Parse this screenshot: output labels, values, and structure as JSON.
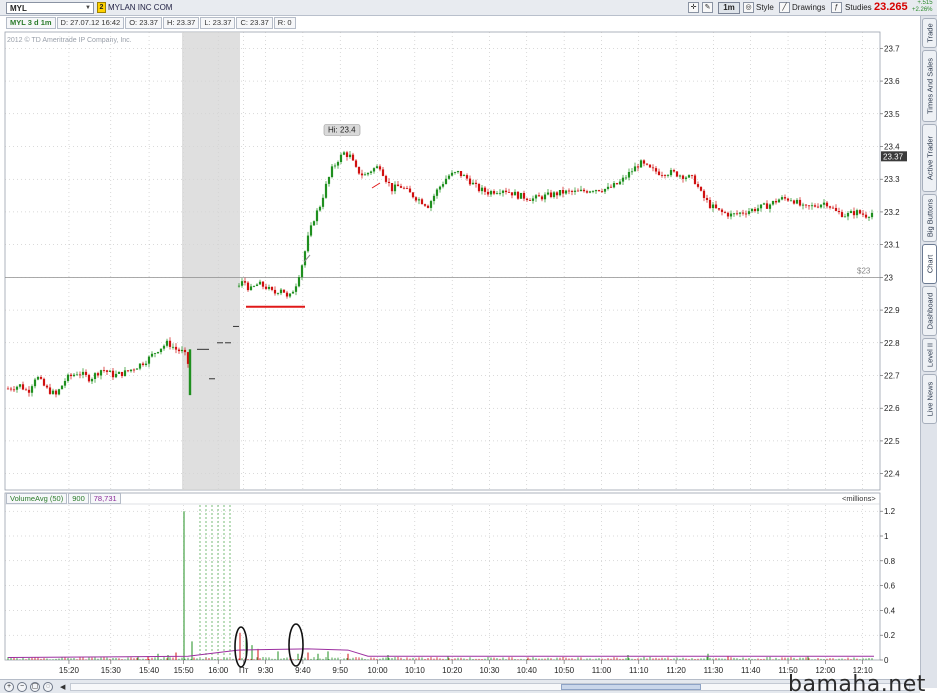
{
  "toolbar": {
    "symbol": "MYL",
    "link_group": "2",
    "company": "MYLAN INC COM",
    "timeframe_label": "1m",
    "style_label": "Style",
    "drawings_label": "Drawings",
    "studies_label": "Studies",
    "last_price": "23.265",
    "change_top": "+.515",
    "change_bottom": "+2.26%"
  },
  "infobar": {
    "study": "MYL 3 d 1m",
    "date": "D: 27.07.12 16:42",
    "open": "O: 23.37",
    "high": "H: 23.37",
    "low": "L: 23.37",
    "close": "C: 23.37",
    "range": "R: 0"
  },
  "copyright": "2012 © TD Ameritrade IP Company, Inc.",
  "side_tabs": [
    "Trade",
    "Times And Sales",
    "Active Trader",
    "Big Buttons",
    "Chart",
    "Dashboard",
    "Level II",
    "Live News"
  ],
  "side_tab_active": "Chart",
  "volume_header": {
    "study": "VolumeAvg (50)",
    "value1": "900",
    "value2": "78,731",
    "units": "<millions>"
  },
  "watermark": "bamaha.net",
  "chart_data": {
    "type": "candlestick",
    "price_axis_ticks": [
      "23.7",
      "23.6",
      "23.5",
      "23.4",
      "23.3",
      "23.2",
      "23.1",
      "23",
      "22.9",
      "22.8",
      "22.7",
      "22.6",
      "22.5",
      "22.4"
    ],
    "price_ylim": [
      22.35,
      23.75
    ],
    "volume_axis_ticks": [
      "1.2",
      "1",
      "0.8",
      "0.6",
      "0.4",
      "0.2",
      "0"
    ],
    "volume_ylim": [
      0,
      1.25
    ],
    "time_ticks": [
      "15:20",
      "15:30",
      "15:40",
      "15:50",
      "16:00",
      "Пт",
      "9:30",
      "9:40",
      "9:50",
      "10:00",
      "10:10",
      "10:20",
      "10:30",
      "10:40",
      "10:50",
      "11:00",
      "11:10",
      "11:20",
      "11:30",
      "11:40",
      "11:50",
      "12:00",
      "12:10",
      "12:20"
    ],
    "high_label": "Hi: 23.4",
    "current_price_label": "23.37",
    "horizontal_line_label": "$23",
    "horizontal_line_value": 23.0,
    "support_line_value": 22.91,
    "grid": true,
    "colors": {
      "up": "#1f8f1f",
      "down": "#d01010",
      "volume_avg": "#9c2fa0",
      "extended_hours": "#d4d4d4"
    },
    "price_path": [
      [
        0,
        22.66
      ],
      [
        12,
        22.67
      ],
      [
        20,
        22.65
      ],
      [
        28,
        22.7
      ],
      [
        38,
        22.66
      ],
      [
        48,
        22.64
      ],
      [
        58,
        22.69
      ],
      [
        70,
        22.71
      ],
      [
        82,
        22.69
      ],
      [
        94,
        22.72
      ],
      [
        106,
        22.7
      ],
      [
        118,
        22.71
      ],
      [
        130,
        22.73
      ],
      [
        140,
        22.75
      ],
      [
        150,
        22.78
      ],
      [
        160,
        22.8
      ],
      [
        168,
        22.78
      ],
      [
        176,
        22.77
      ],
      [
        182,
        22.72
      ],
      [
        230,
        22.97
      ],
      [
        236,
        22.99
      ],
      [
        242,
        22.96
      ],
      [
        250,
        22.98
      ],
      [
        258,
        22.97
      ],
      [
        266,
        22.95
      ],
      [
        274,
        22.97
      ],
      [
        280,
        22.93
      ],
      [
        288,
        22.98
      ],
      [
        294,
        23.04
      ],
      [
        300,
        23.12
      ],
      [
        306,
        23.18
      ],
      [
        312,
        23.22
      ],
      [
        318,
        23.28
      ],
      [
        324,
        23.33
      ],
      [
        330,
        23.36
      ],
      [
        336,
        23.38
      ],
      [
        342,
        23.37
      ],
      [
        348,
        23.33
      ],
      [
        356,
        23.31
      ],
      [
        364,
        23.33
      ],
      [
        372,
        23.34
      ],
      [
        378,
        23.3
      ],
      [
        384,
        23.27
      ],
      [
        392,
        23.28
      ],
      [
        400,
        23.26
      ],
      [
        410,
        23.24
      ],
      [
        420,
        23.22
      ],
      [
        430,
        23.27
      ],
      [
        440,
        23.31
      ],
      [
        450,
        23.32
      ],
      [
        460,
        23.3
      ],
      [
        470,
        23.27
      ],
      [
        480,
        23.26
      ],
      [
        495,
        23.27
      ],
      [
        510,
        23.25
      ],
      [
        525,
        23.24
      ],
      [
        540,
        23.25
      ],
      [
        555,
        23.26
      ],
      [
        570,
        23.26
      ],
      [
        585,
        23.27
      ],
      [
        600,
        23.27
      ],
      [
        612,
        23.29
      ],
      [
        622,
        23.32
      ],
      [
        632,
        23.35
      ],
      [
        642,
        23.33
      ],
      [
        652,
        23.32
      ],
      [
        664,
        23.32
      ],
      [
        676,
        23.31
      ],
      [
        686,
        23.3
      ],
      [
        694,
        23.25
      ],
      [
        702,
        23.22
      ],
      [
        712,
        23.2
      ],
      [
        724,
        23.19
      ],
      [
        736,
        23.2
      ],
      [
        748,
        23.21
      ],
      [
        760,
        23.22
      ],
      [
        772,
        23.24
      ],
      [
        784,
        23.24
      ],
      [
        796,
        23.21
      ],
      [
        808,
        23.22
      ],
      [
        818,
        23.23
      ],
      [
        828,
        23.2
      ],
      [
        838,
        23.19
      ],
      [
        848,
        23.2
      ],
      [
        858,
        23.19
      ],
      [
        866,
        23.2
      ]
    ],
    "extended_bars": [
      [
        192,
        22.78
      ],
      [
        198,
        22.78
      ],
      [
        204,
        22.69
      ],
      [
        212,
        22.8
      ],
      [
        220,
        22.8
      ],
      [
        228,
        22.85
      ]
    ],
    "volume_spikes": [
      [
        176,
        1.2
      ],
      [
        168,
        0.06
      ],
      [
        160,
        0.04
      ],
      [
        150,
        0.05
      ],
      [
        140,
        0.03
      ],
      [
        130,
        0.03
      ],
      [
        184,
        0.15
      ],
      [
        232,
        0.22
      ],
      [
        238,
        0.18
      ],
      [
        244,
        0.12
      ],
      [
        250,
        0.09
      ],
      [
        270,
        0.07
      ],
      [
        290,
        0.05
      ],
      [
        300,
        0.06
      ],
      [
        310,
        0.05
      ],
      [
        320,
        0.07
      ],
      [
        340,
        0.05
      ],
      [
        380,
        0.04
      ],
      [
        440,
        0.03
      ],
      [
        520,
        0.02
      ],
      [
        620,
        0.04
      ],
      [
        700,
        0.05
      ],
      [
        720,
        0.03
      ],
      [
        800,
        0.03
      ]
    ],
    "avg_volume_path": [
      [
        0,
        0.02
      ],
      [
        180,
        0.03
      ],
      [
        230,
        0.08
      ],
      [
        300,
        0.09
      ],
      [
        340,
        0.08
      ],
      [
        360,
        0.03
      ],
      [
        866,
        0.03
      ]
    ]
  }
}
